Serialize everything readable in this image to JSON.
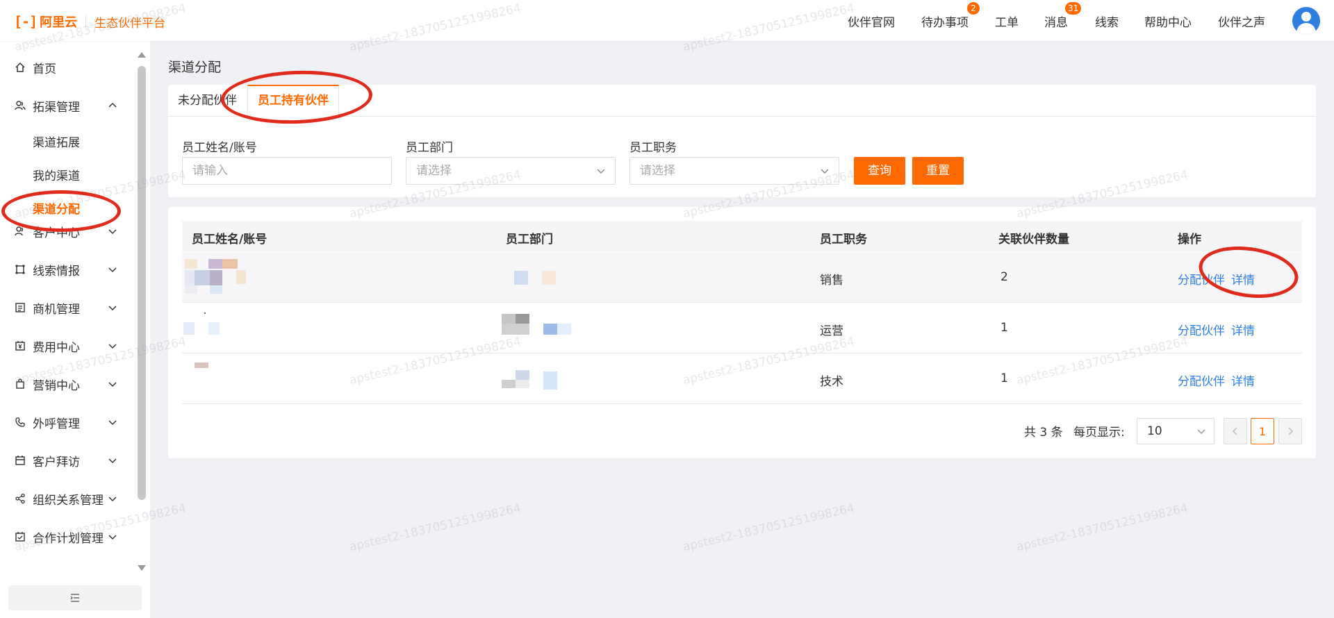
{
  "header": {
    "logo_mark": "[-]",
    "logo_name": "阿里云",
    "platform": "生态伙伴平台",
    "nav": [
      {
        "label": "伙伴官网"
      },
      {
        "label": "待办事项",
        "badge": "2"
      },
      {
        "label": "工单"
      },
      {
        "label": "消息",
        "badge": "31"
      },
      {
        "label": "线索"
      },
      {
        "label": "帮助中心"
      },
      {
        "label": "伙伴之声"
      }
    ],
    "avatar_icon": "user-avatar-icon"
  },
  "sidebar": {
    "items": [
      {
        "label": "首页",
        "icon": "home-icon"
      },
      {
        "label": "拓渠管理",
        "icon": "users-icon",
        "expanded": true,
        "children": [
          {
            "label": "渠道拓展"
          },
          {
            "label": "我的渠道"
          },
          {
            "label": "渠道分配",
            "active": true
          }
        ]
      },
      {
        "label": "客户中心",
        "icon": "customer-icon"
      },
      {
        "label": "线索情报",
        "icon": "lead-icon"
      },
      {
        "label": "商机管理",
        "icon": "opportunity-icon"
      },
      {
        "label": "费用中心",
        "icon": "fee-icon"
      },
      {
        "label": "营销中心",
        "icon": "marketing-icon"
      },
      {
        "label": "外呼管理",
        "icon": "phone-icon"
      },
      {
        "label": "客户拜访",
        "icon": "calendar-icon"
      },
      {
        "label": "组织关系管理",
        "icon": "share-icon"
      },
      {
        "label": "合作计划管理",
        "icon": "plan-icon"
      }
    ]
  },
  "main": {
    "page_title": "渠道分配",
    "tabs": [
      {
        "label": "未分配伙伴"
      },
      {
        "label": "员工持有伙伴",
        "active": true
      }
    ],
    "filters": {
      "name_label": "员工姓名/账号",
      "name_placeholder": "请输入",
      "dept_label": "员工部门",
      "dept_placeholder": "请选择",
      "role_label": "员工职务",
      "role_placeholder": "请选择",
      "query_button": "查询",
      "reset_button": "重置"
    },
    "table": {
      "columns": [
        "员工姓名/账号",
        "员工部门",
        "员工职务",
        "关联伙伴数量",
        "操作"
      ],
      "rows": [
        {
          "role": "销售",
          "count": "2",
          "actions": [
            "分配伙伴",
            "详情"
          ]
        },
        {
          "role": "运营",
          "count": "1",
          "actions": [
            "分配伙伴",
            "详情"
          ]
        },
        {
          "role": "技术",
          "count": "1",
          "actions": [
            "分配伙伴",
            "详情"
          ]
        }
      ]
    },
    "pagination": {
      "total": "共 3 条",
      "per_page_label": "每页显示:",
      "per_page": "10",
      "current": "1"
    }
  },
  "watermark": "apstest2-1837051251998264",
  "colors": {
    "accent": "#ff6a00",
    "link": "#2f7fe0",
    "annotation": "#e02b1c"
  }
}
